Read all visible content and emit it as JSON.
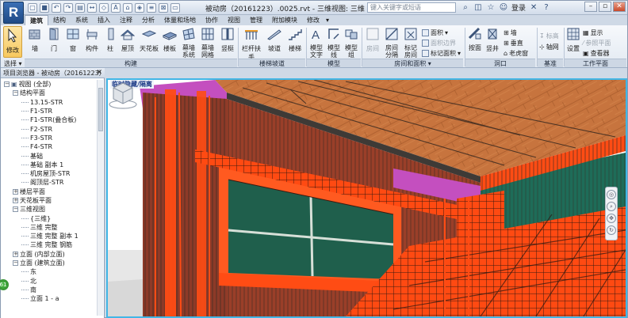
{
  "app": {
    "logo_letter": "R"
  },
  "titlebar": {
    "title": "被动房（20161223）.0025.rvt - 三维视图: 三维",
    "search_placeholder": "键入关键字或短语",
    "login_label": "登录",
    "quick_access": [
      "open-icon",
      "save-icon",
      "undo-icon",
      "redo-icon",
      "print-icon",
      "measure-icon",
      "tag-icon",
      "text-icon",
      "3d-view-icon",
      "section-icon",
      "thin-lines-icon",
      "close-hidden-icon",
      "switch-windows-icon"
    ]
  },
  "tabs": [
    {
      "label": "建筑",
      "active": true
    },
    {
      "label": "结构"
    },
    {
      "label": "系统"
    },
    {
      "label": "插入"
    },
    {
      "label": "注释"
    },
    {
      "label": "分析"
    },
    {
      "label": "体量和场地"
    },
    {
      "label": "协作"
    },
    {
      "label": "视图"
    },
    {
      "label": "管理"
    },
    {
      "label": "附加模块"
    },
    {
      "label": "修改"
    }
  ],
  "ribbon": {
    "modify": "修改",
    "select_label": "选择",
    "groups": {
      "build": "构建",
      "circulation": "楼梯坡道",
      "model": "模型",
      "room": "房间和面积",
      "opening": "洞口",
      "datum": "基准",
      "workplane": "工作平面"
    },
    "build_buttons": [
      "墙",
      "门",
      "窗",
      "构件",
      "柱",
      "屋顶",
      "天花板",
      "楼板",
      "幕墙系统",
      "幕墙网格",
      "竖梃"
    ],
    "circulation_buttons": [
      "栏杆扶手",
      "坡道",
      "楼梯"
    ],
    "model_buttons": [
      "模型文字",
      "模型线",
      "模型组"
    ],
    "room_buttons": [
      "房间",
      "房间分隔",
      "标记房间"
    ],
    "room_small": [
      "面积",
      "面积边界",
      "标记面积"
    ],
    "opening_buttons": [
      "按面",
      "竖井"
    ],
    "opening_small": [
      "墙",
      "垂直",
      "老虎窗"
    ],
    "datum_small": [
      "标高",
      "轴网"
    ],
    "workplane_buttons": [
      "设置"
    ],
    "workplane_small": [
      "显示",
      "参照平面",
      "查看器"
    ]
  },
  "project_browser": {
    "title": "项目浏览器 - 被动房（20161223）",
    "tree": [
      {
        "label": "视图 (全部)",
        "level": 0,
        "toggle": "-",
        "icon": true
      },
      {
        "label": "结构平面",
        "level": 1,
        "toggle": "-"
      },
      {
        "label": "13.15-STR",
        "level": 2
      },
      {
        "label": "F1-STR",
        "level": 2
      },
      {
        "label": "F1-STR(叠合板)",
        "level": 2
      },
      {
        "label": "F2-STR",
        "level": 2
      },
      {
        "label": "F3-STR",
        "level": 2
      },
      {
        "label": "F4-STR",
        "level": 2
      },
      {
        "label": "基础",
        "level": 2
      },
      {
        "label": "基础 副本 1",
        "level": 2
      },
      {
        "label": "机房屋顶-STR",
        "level": 2
      },
      {
        "label": "阁顶层-STR",
        "level": 2
      },
      {
        "label": "楼层平面",
        "level": 1,
        "toggle": "+"
      },
      {
        "label": "天花板平面",
        "level": 1,
        "toggle": "+"
      },
      {
        "label": "三维视图",
        "level": 1,
        "toggle": "-"
      },
      {
        "label": "{三维}",
        "level": 2
      },
      {
        "label": "三维 完整",
        "level": 2
      },
      {
        "label": "三维 完整 副本 1",
        "level": 2
      },
      {
        "label": "三维 完整 钢筋",
        "level": 2
      },
      {
        "label": "立面 (内部立面)",
        "level": 1,
        "toggle": "+"
      },
      {
        "label": "立面 (建筑立面)",
        "level": 1,
        "toggle": "-"
      },
      {
        "label": "东",
        "level": 2
      },
      {
        "label": "北",
        "level": 2
      },
      {
        "label": "南",
        "level": 2
      },
      {
        "label": "立面 1 - a",
        "level": 2
      }
    ],
    "nav_badge": "61"
  },
  "viewport": {
    "label": "临时隐藏/隔离",
    "colors": {
      "wood": "#c8753f",
      "wall": "#8d3a28",
      "rebar": "#ff4c14",
      "magenta": "#c44fbf",
      "glass": "#1f5f4c",
      "border": "#41b6e6"
    }
  }
}
